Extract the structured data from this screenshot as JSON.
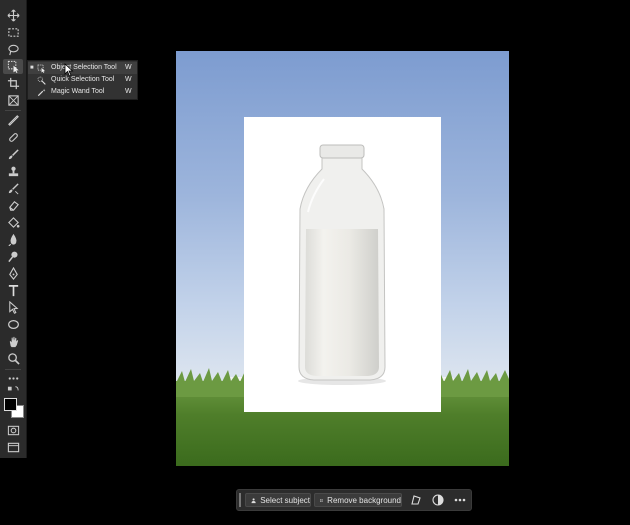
{
  "flyout": {
    "items": [
      {
        "label": "Object Selection Tool",
        "shortcut": "W",
        "icon": "object-selection-icon"
      },
      {
        "label": "Quick Selection Tool",
        "shortcut": "W",
        "icon": "quick-selection-icon"
      },
      {
        "label": "Magic Wand Tool",
        "shortcut": "W",
        "icon": "magic-wand-icon"
      }
    ]
  },
  "toolbar": {
    "tools": [
      "move-icon",
      "marquee-icon",
      "lasso-icon",
      "object-selection-icon",
      "crop-icon",
      "frame-icon",
      "eyedropper-icon",
      "healing-brush-icon",
      "brush-icon",
      "clone-stamp-icon",
      "history-brush-icon",
      "eraser-icon",
      "paint-bucket-icon",
      "blur-icon",
      "dodge-icon",
      "pen-icon",
      "type-icon",
      "path-selection-icon",
      "ellipse-icon",
      "hand-icon",
      "zoom-icon",
      "more-tools-icon"
    ],
    "foreground_color": "#000000",
    "background_color": "#ffffff"
  },
  "taskbar": {
    "select_subject": "Select subject",
    "remove_background": "Remove background"
  },
  "colors": {
    "panel": "#2b2b2b",
    "canvas_bg": "#000000"
  }
}
